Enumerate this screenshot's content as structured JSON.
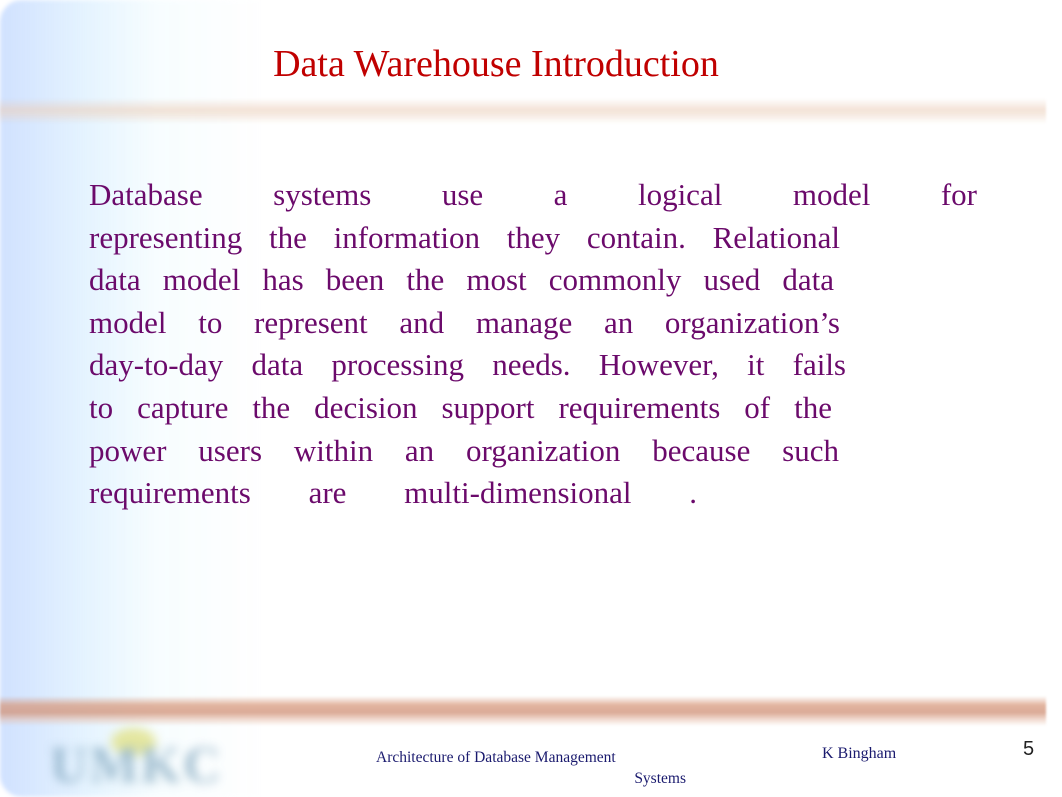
{
  "slide": {
    "title": "Data Warehouse Introduction",
    "body_lines": [
      "Database systems use a logical model for",
      "representing the information they contain. Relational",
      "data model has been the most commonly used data",
      "model to represent and manage an organization’s",
      "day-to-day data processing needs. However, it fails",
      "to capture the decision support requirements of the",
      "power users within an organization because such",
      "requirements are multi-dimensional ."
    ],
    "footer": {
      "course_line1": "Architecture of Database Management",
      "course_line2": "Systems",
      "author": "K Bingham",
      "page_number": "5"
    },
    "logo_text": "UMKC",
    "colors": {
      "title": "#c00000",
      "body": "#6b0a6b",
      "footer": "#1a1a6e"
    }
  }
}
